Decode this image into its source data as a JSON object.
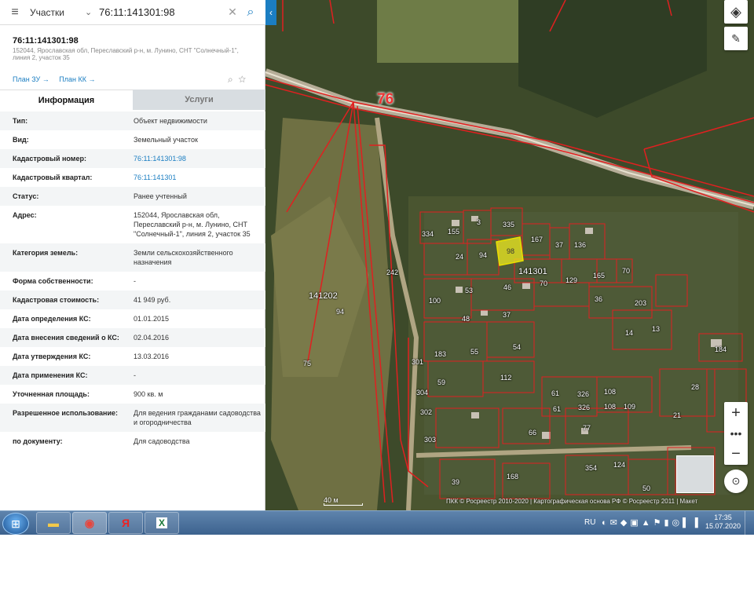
{
  "search": {
    "category": "Участки",
    "value": "76:11:141301:98"
  },
  "parcel": {
    "number": "76:11:141301:98",
    "address_short": "152044, Ярославская обл, Переславский р-н, м. Лунино, СНТ \"Солнечный-1\", линия 2, участок 35",
    "link_zu": "План ЗУ →",
    "link_kk": "План КК →"
  },
  "tabs": {
    "info": "Информация",
    "services": "Услуги"
  },
  "info_rows": [
    {
      "key": "Тип:",
      "value": "Объект недвижимости"
    },
    {
      "key": "Вид:",
      "value": "Земельный участок"
    },
    {
      "key": "Кадастровый номер:",
      "value": "76:11:141301:98"
    },
    {
      "key": "Кадастровый квартал:",
      "value": "76:11:141301"
    },
    {
      "key": "Статус:",
      "value": "Ранее учтенный"
    },
    {
      "key": "Адрес:",
      "value": "152044, Ярославская обл, Переславский р-н, м. Лунино, СНТ \"Солнечный-1\", линия 2, участок 35"
    },
    {
      "key": "Категория земель:",
      "value": "Земли сельскохозяйственного назначения"
    },
    {
      "key": "Форма собственности:",
      "value": "-"
    },
    {
      "key": "Кадастровая стоимость:",
      "value": "41 949 руб."
    },
    {
      "key": "Дата определения КС:",
      "value": "01.01.2015"
    },
    {
      "key": "Дата внесения сведений о КС:",
      "value": "02.04.2016"
    },
    {
      "key": "Дата утверждения КС:",
      "value": "13.03.2016"
    },
    {
      "key": "Дата применения КС:",
      "value": "-"
    },
    {
      "key": "Уточненная площадь:",
      "value": "900 кв. м"
    },
    {
      "key": "Разрешенное использование:",
      "value": "Для ведения гражданами садоводства и огородничества"
    },
    {
      "key": "по документу:",
      "value": "Для садоводства"
    }
  ],
  "map": {
    "road_label": "76",
    "quarter_labels": [
      "141202",
      "141301"
    ],
    "parcel_labels": [
      "334",
      "155",
      "3",
      "335",
      "167",
      "37",
      "136",
      "94",
      "98",
      "24",
      "129",
      "165",
      "53",
      "46",
      "70",
      "36",
      "203",
      "100",
      "37",
      "48",
      "14",
      "13",
      "183",
      "55",
      "54",
      "184",
      "59",
      "112",
      "61",
      "326",
      "108",
      "109",
      "21",
      "66",
      "77",
      "39",
      "168",
      "354",
      "124",
      "50",
      "326",
      "61",
      "108",
      "28",
      "301",
      "304",
      "302",
      "303",
      "242",
      "94",
      "70",
      "75"
    ],
    "scale_label": "40 м",
    "copyright": "ПКК © Росреестр 2010-2020 | Картографическая основа РФ © Росреестр 2011 | Макет"
  },
  "taskbar": {
    "language": "RU",
    "time": "17:35",
    "date": "15.07.2020"
  }
}
